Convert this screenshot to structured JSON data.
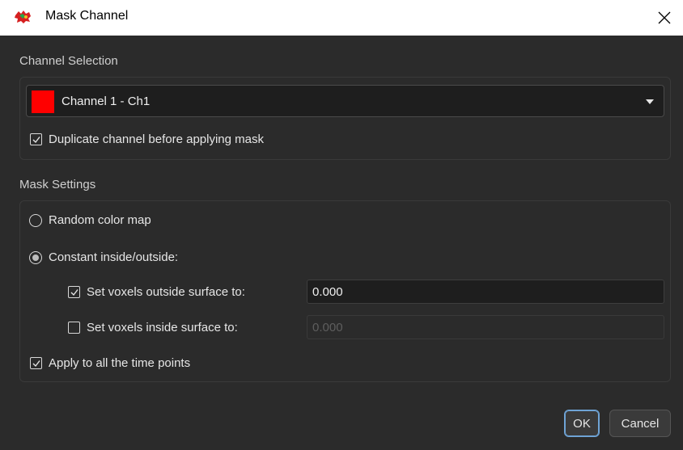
{
  "window": {
    "title": "Mask Channel",
    "close_symbol": "✕"
  },
  "channel_selection": {
    "label": "Channel Selection",
    "selected_channel": "Channel 1 - Ch1",
    "channel_color": "#ff0000",
    "duplicate_checkbox": {
      "label": "Duplicate channel before applying mask",
      "checked": true
    }
  },
  "mask_settings": {
    "label": "Mask Settings",
    "random_color_map": {
      "label": "Random color map",
      "selected": false
    },
    "constant_inside_outside": {
      "label": "Constant inside/outside:",
      "selected": true
    },
    "outside_surface": {
      "label": "Set voxels outside surface to:",
      "checked": true,
      "value": "0.000"
    },
    "inside_surface": {
      "label": "Set voxels inside surface to:",
      "checked": false,
      "value": "0.000"
    },
    "apply_all_time_points": {
      "label": "Apply to all the time points",
      "checked": true
    }
  },
  "buttons": {
    "ok": "OK",
    "cancel": "Cancel"
  },
  "colors": {
    "background": "#2b2b2b",
    "accent_focus": "#6fa4d6"
  }
}
